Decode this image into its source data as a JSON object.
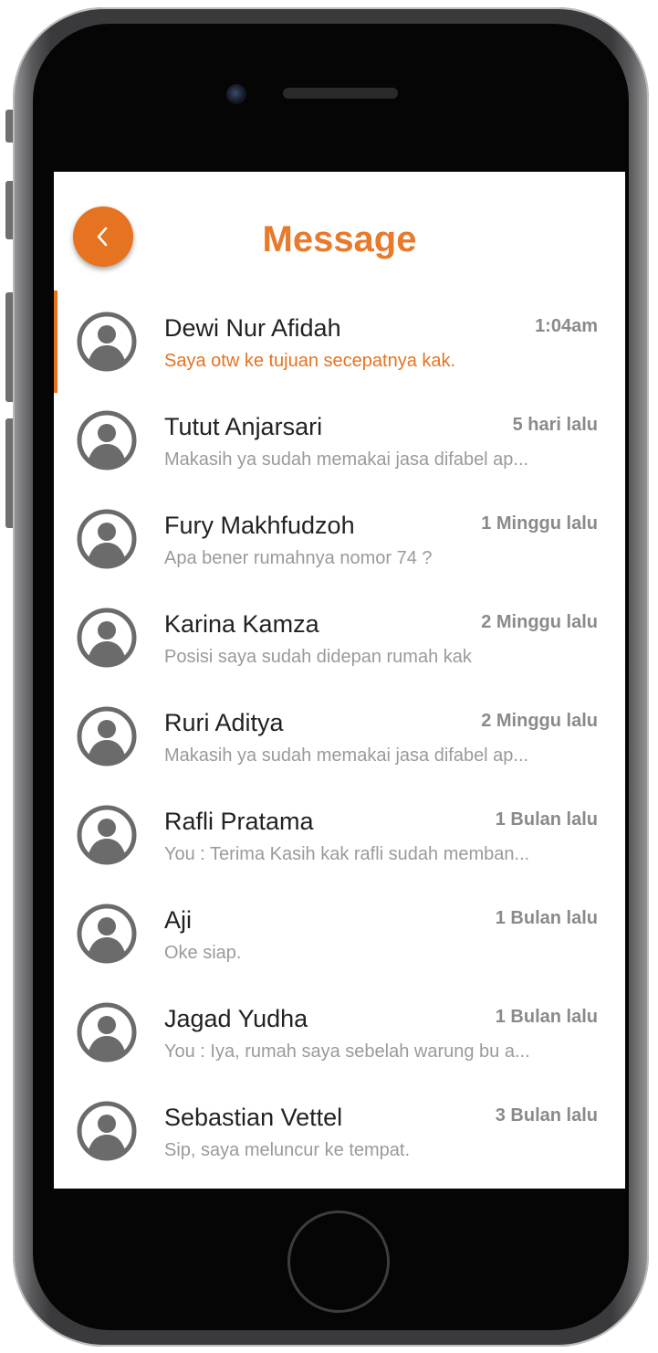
{
  "header": {
    "title": "Message",
    "back_icon": "chevron-left-icon",
    "accent_color": "#E57320"
  },
  "conversations": [
    {
      "name": "Dewi Nur Afidah",
      "time": "1:04am",
      "message": "Saya otw ke tujuan secepatnya kak.",
      "unread": true
    },
    {
      "name": "Tutut Anjarsari",
      "time": "5 hari lalu",
      "message": "Makasih ya sudah memakai jasa difabel ap..."
    },
    {
      "name": "Fury Makhfudzoh",
      "time": "1 Minggu lalu",
      "message": "Apa bener rumahnya nomor 74 ?"
    },
    {
      "name": "Karina Kamza",
      "time": "2 Minggu lalu",
      "message": "Posisi saya sudah didepan rumah kak"
    },
    {
      "name": "Ruri Aditya",
      "time": "2 Minggu lalu",
      "message": "Makasih ya sudah memakai jasa difabel ap..."
    },
    {
      "name": "Rafli Pratama",
      "time": "1 Bulan lalu",
      "message": "You : Terima Kasih kak rafli sudah memban..."
    },
    {
      "name": "Aji",
      "time": "1 Bulan lalu",
      "message": "Oke siap."
    },
    {
      "name": "Jagad Yudha",
      "time": "1 Bulan lalu",
      "message": "You : Iya, rumah saya sebelah warung bu a..."
    },
    {
      "name": "Sebastian Vettel",
      "time": "3 Bulan lalu",
      "message": "Sip, saya meluncur ke tempat."
    }
  ]
}
